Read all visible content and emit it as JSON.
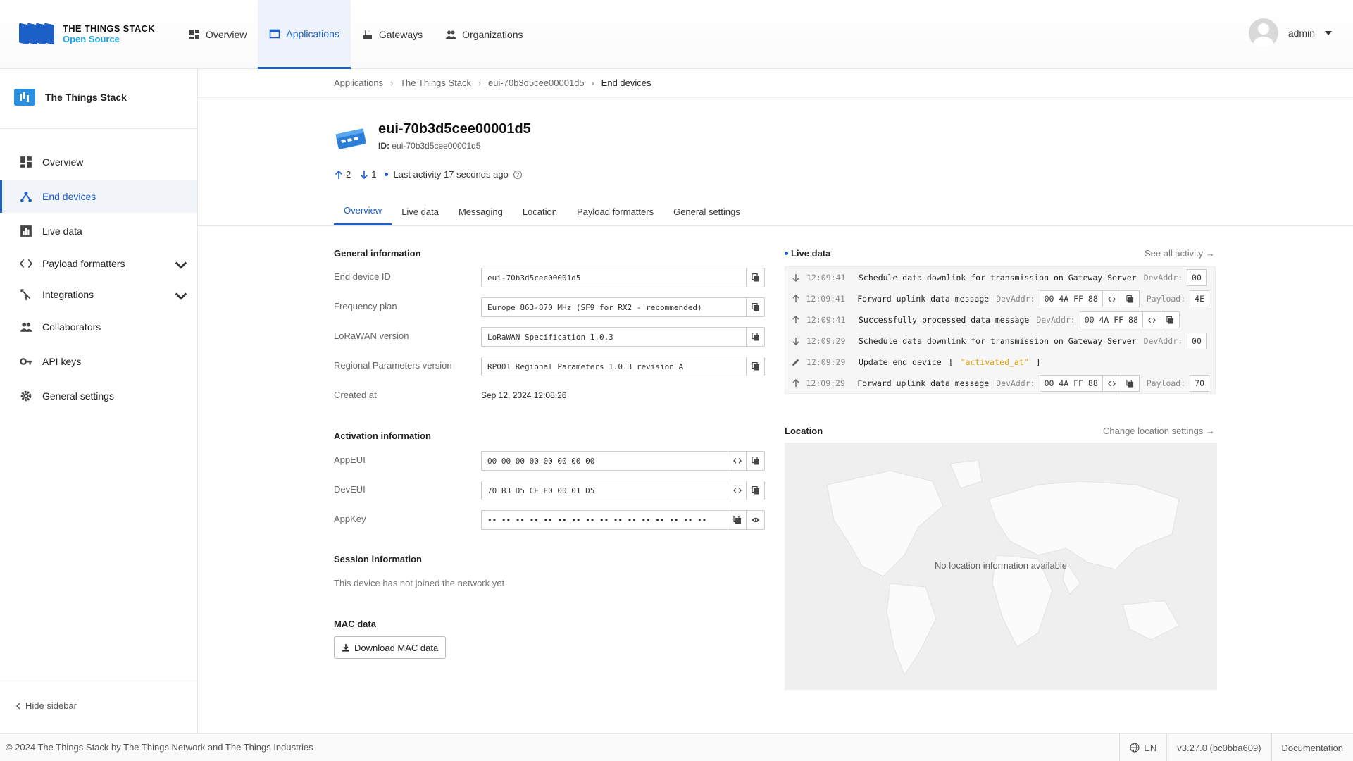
{
  "header": {
    "logo": {
      "line1": "THE THINGS STACK",
      "line2": "Open Source"
    },
    "nav": [
      {
        "label": "Overview",
        "icon": "grid-icon"
      },
      {
        "label": "Applications",
        "icon": "window-icon",
        "active": true
      },
      {
        "label": "Gateways",
        "icon": "gateway-icon"
      },
      {
        "label": "Organizations",
        "icon": "people-icon"
      }
    ],
    "user": "admin"
  },
  "sidebar": {
    "app_name": "The Things Stack",
    "items": [
      {
        "label": "Overview"
      },
      {
        "label": "End devices",
        "active": true
      },
      {
        "label": "Live data"
      },
      {
        "label": "Payload formatters"
      },
      {
        "label": "Integrations"
      },
      {
        "label": "Collaborators"
      },
      {
        "label": "API keys"
      },
      {
        "label": "General settings"
      }
    ],
    "hide_label": "Hide sidebar"
  },
  "breadcrumb": [
    "Applications",
    "The Things Stack",
    "eui-70b3d5cee00001d5",
    "End devices"
  ],
  "device": {
    "title": "eui-70b3d5cee00001d5",
    "id_label": "ID:",
    "id": "eui-70b3d5cee00001d5",
    "uplinks": "2",
    "downlinks": "1",
    "last_activity": "Last activity 17 seconds ago"
  },
  "tabs": [
    "Overview",
    "Live data",
    "Messaging",
    "Location",
    "Payload formatters",
    "General settings"
  ],
  "general": {
    "title": "General information",
    "fields": [
      {
        "label": "End device ID",
        "value": "eui-70b3d5cee00001d5"
      },
      {
        "label": "Frequency plan",
        "value": "Europe 863-870 MHz (SF9 for RX2 - recommended)"
      },
      {
        "label": "LoRaWAN version",
        "value": "LoRaWAN Specification 1.0.3"
      },
      {
        "label": "Regional Parameters version",
        "value": "RP001 Regional Parameters 1.0.3 revision A"
      }
    ],
    "created_label": "Created at",
    "created_value": "Sep 12, 2024 12:08:26"
  },
  "activation": {
    "title": "Activation information",
    "fields": [
      {
        "label": "AppEUI",
        "value": "00 00 00 00 00 00 00 00"
      },
      {
        "label": "DevEUI",
        "value": "70 B3 D5 CE E0 00 01 D5"
      },
      {
        "label": "AppKey",
        "value": "•• •• •• •• •• •• •• •• •• •• •• •• •• •• •• ••"
      }
    ]
  },
  "session": {
    "title": "Session information",
    "text": "This device has not joined the network yet"
  },
  "mac": {
    "title": "MAC data",
    "button": "Download MAC data"
  },
  "live_data": {
    "title": "Live data",
    "link": "See all activity →",
    "rows": [
      {
        "dir": "down",
        "time": "12:09:41",
        "msg": "Schedule data downlink for transmission on Gateway Server",
        "key": "DevAddr:",
        "chip": "00"
      },
      {
        "dir": "up",
        "time": "12:09:41",
        "msg": "Forward uplink data message",
        "key": "DevAddr:",
        "chip": "00 4A FF 88",
        "key2": "Payload:",
        "chip2": "4E"
      },
      {
        "dir": "up",
        "time": "12:09:41",
        "msg": "Successfully processed data message",
        "key": "DevAddr:",
        "chip": "00 4A FF 88"
      },
      {
        "dir": "down",
        "time": "12:09:29",
        "msg": "Schedule data downlink for transmission on Gateway Server",
        "key": "DevAddr:",
        "chip": "00"
      },
      {
        "dir": "edit",
        "time": "12:09:29",
        "msg": "Update end device",
        "bracket_open": "[",
        "str": "\"activated_at\"",
        "bracket_close": "]"
      },
      {
        "dir": "up",
        "time": "12:09:29",
        "msg": "Forward uplink data message",
        "key": "DevAddr:",
        "chip": "00 4A FF 88",
        "key2": "Payload:",
        "chip2": "70"
      }
    ]
  },
  "location": {
    "title": "Location",
    "link": "Change location settings →",
    "empty": "No location information available"
  },
  "footer": {
    "copyright": "© 2024 The Things Stack by The Things Network and The Things Industries",
    "lang": "EN",
    "version": "v3.27.0 (bc0bba609)",
    "docs": "Documentation"
  },
  "colors": {
    "accent": "#1c5fc7",
    "logo_blue": "#1ba2e0",
    "string_yellow": "#e0a000"
  }
}
